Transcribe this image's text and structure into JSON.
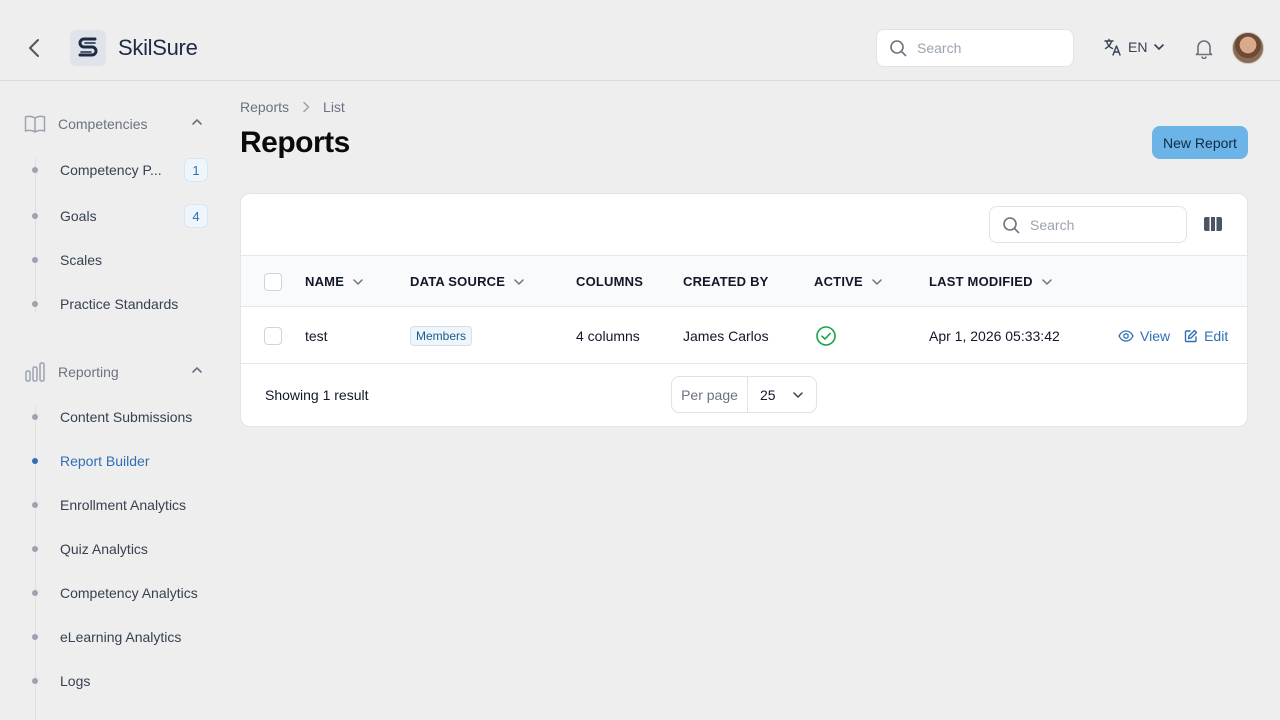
{
  "app": {
    "name": "SkilSure"
  },
  "header": {
    "search_placeholder": "Search",
    "language": "EN"
  },
  "sidebar": {
    "groups": [
      {
        "label": "Competencies",
        "items": [
          {
            "label": "Competency P...",
            "badge": "1"
          },
          {
            "label": "Goals",
            "badge": "4"
          },
          {
            "label": "Scales"
          },
          {
            "label": "Practice Standards"
          }
        ]
      },
      {
        "label": "Reporting",
        "items": [
          {
            "label": "Content Submissions"
          },
          {
            "label": "Report Builder",
            "active": true
          },
          {
            "label": "Enrollment Analytics"
          },
          {
            "label": "Quiz Analytics"
          },
          {
            "label": "Competency Analytics"
          },
          {
            "label": "eLearning Analytics"
          },
          {
            "label": "Logs"
          }
        ]
      }
    ]
  },
  "breadcrumb": [
    "Reports",
    "List"
  ],
  "page": {
    "title": "Reports",
    "new_button": "New Report"
  },
  "table": {
    "search_placeholder": "Search",
    "columns": [
      "NAME",
      "DATA SOURCE",
      "COLUMNS",
      "CREATED BY",
      "ACTIVE",
      "LAST MODIFIED"
    ],
    "rows": [
      {
        "name": "test",
        "data_source": "Members",
        "columns": "4 columns",
        "created_by": "James Carlos",
        "active": true,
        "last_modified": "Apr 1, 2026 05:33:42",
        "actions": [
          "View",
          "Edit"
        ]
      }
    ],
    "footer": {
      "showing": "Showing 1 result",
      "per_page_label": "Per page",
      "per_page_value": "25"
    }
  },
  "colors": {
    "accent": "#2e6fb5",
    "primary_button": "#6cb4e8",
    "success": "#16a34a"
  }
}
